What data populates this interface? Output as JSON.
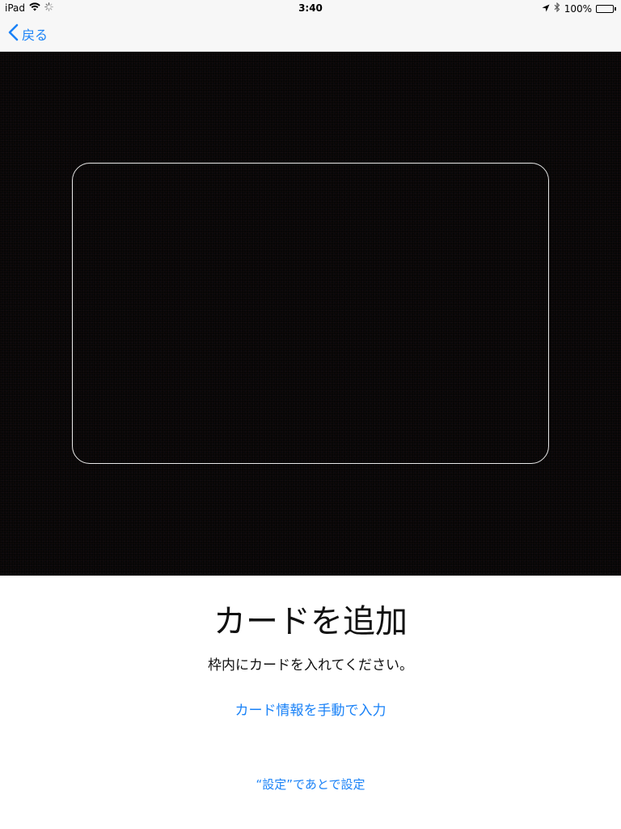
{
  "status_bar": {
    "device": "iPad",
    "time": "3:40",
    "battery": "100%",
    "battery_level": 1.0
  },
  "nav": {
    "back_label": "戻る",
    "accent_color": "#1a82f7"
  },
  "main": {
    "title": "カードを追加",
    "subtitle": "枠内にカードを入れてください。",
    "manual_entry_label": "カード情報を手動で入力",
    "later_label": "“設定”であとで設定"
  },
  "icons": {
    "wifi": "wifi-icon",
    "activity": "activity-spinner-icon",
    "location": "location-arrow-icon",
    "bluetooth": "bluetooth-icon",
    "battery": "battery-icon",
    "back": "chevron-left-icon"
  }
}
